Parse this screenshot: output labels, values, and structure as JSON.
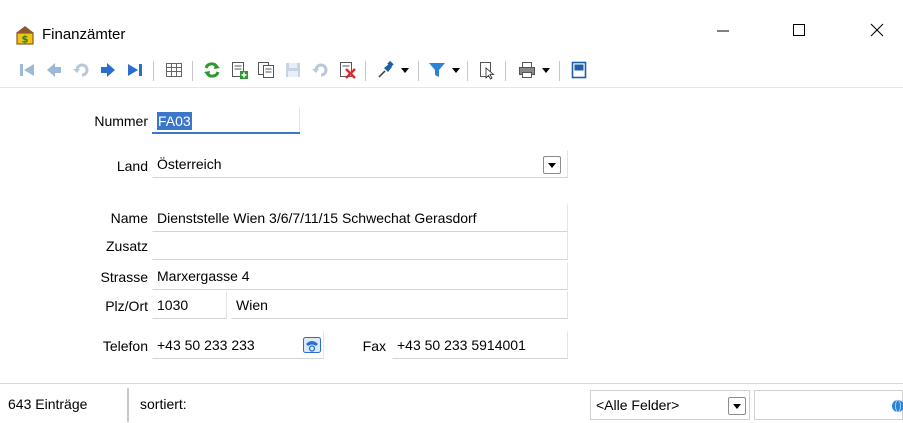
{
  "window": {
    "title": "Finanzämter",
    "app_icon": "finanzamt-building-icon",
    "controls": [
      "minimize-icon",
      "maximize-icon",
      "close-icon"
    ]
  },
  "toolbar": {
    "buttons": [
      "first-record-icon",
      "previous-record-icon",
      "undo-navigation-icon",
      "next-record-icon",
      "last-record-icon",
      "table-view-icon",
      "refresh-icon",
      "new-record-icon",
      "copy-record-icon",
      "save-icon",
      "undo-icon",
      "delete-icon",
      "pin-icon",
      "filter-icon",
      "document-cursor-icon",
      "print-icon",
      "layout-icon"
    ]
  },
  "form": {
    "nummer": {
      "label": "Nummer",
      "value": "FA03"
    },
    "land": {
      "label": "Land",
      "value": "Österreich"
    },
    "name": {
      "label": "Name",
      "value": "Dienststelle Wien 3/6/7/11/15 Schwechat Gerasdorf"
    },
    "zusatz": {
      "label": "Zusatz",
      "value": ""
    },
    "strasse": {
      "label": "Strasse",
      "value": "Marxergasse 4"
    },
    "plzort": {
      "label": "Plz/Ort",
      "plz": "1030",
      "ort": "Wien"
    },
    "telefon": {
      "label": "Telefon",
      "value": "+43 50 233 233"
    },
    "fax": {
      "label": "Fax",
      "value": "+43 50 233 5914001"
    }
  },
  "status": {
    "count": "643 Einträge",
    "sorted_label": "sortiert:",
    "filter_field": "<Alle Felder>",
    "search_value": ""
  },
  "colors": {
    "accent": "#3b76c9",
    "toolbar_green": "#2e9a2e",
    "toolbar_blue": "#2a6fc9",
    "toolbar_red": "#d03030"
  }
}
